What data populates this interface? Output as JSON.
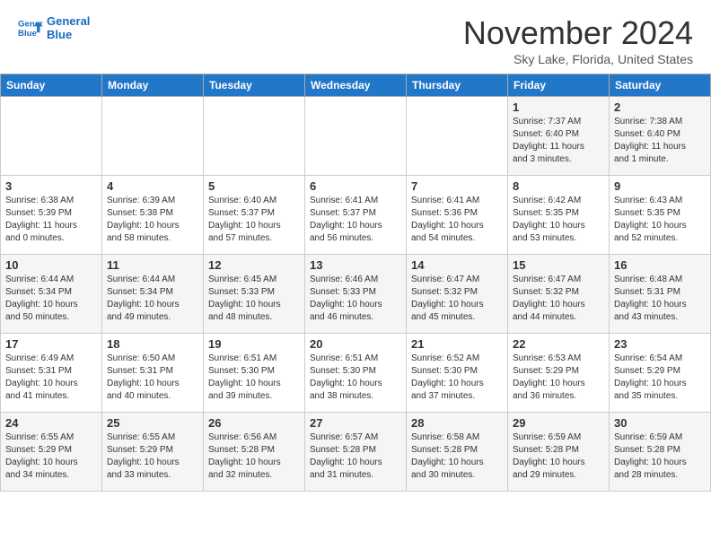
{
  "header": {
    "logo_line1": "General",
    "logo_line2": "Blue",
    "month": "November 2024",
    "location": "Sky Lake, Florida, United States"
  },
  "weekdays": [
    "Sunday",
    "Monday",
    "Tuesday",
    "Wednesday",
    "Thursday",
    "Friday",
    "Saturday"
  ],
  "weeks": [
    [
      {
        "day": "",
        "info": ""
      },
      {
        "day": "",
        "info": ""
      },
      {
        "day": "",
        "info": ""
      },
      {
        "day": "",
        "info": ""
      },
      {
        "day": "",
        "info": ""
      },
      {
        "day": "1",
        "info": "Sunrise: 7:37 AM\nSunset: 6:40 PM\nDaylight: 11 hours\nand 3 minutes."
      },
      {
        "day": "2",
        "info": "Sunrise: 7:38 AM\nSunset: 6:40 PM\nDaylight: 11 hours\nand 1 minute."
      }
    ],
    [
      {
        "day": "3",
        "info": "Sunrise: 6:38 AM\nSunset: 5:39 PM\nDaylight: 11 hours\nand 0 minutes."
      },
      {
        "day": "4",
        "info": "Sunrise: 6:39 AM\nSunset: 5:38 PM\nDaylight: 10 hours\nand 58 minutes."
      },
      {
        "day": "5",
        "info": "Sunrise: 6:40 AM\nSunset: 5:37 PM\nDaylight: 10 hours\nand 57 minutes."
      },
      {
        "day": "6",
        "info": "Sunrise: 6:41 AM\nSunset: 5:37 PM\nDaylight: 10 hours\nand 56 minutes."
      },
      {
        "day": "7",
        "info": "Sunrise: 6:41 AM\nSunset: 5:36 PM\nDaylight: 10 hours\nand 54 minutes."
      },
      {
        "day": "8",
        "info": "Sunrise: 6:42 AM\nSunset: 5:35 PM\nDaylight: 10 hours\nand 53 minutes."
      },
      {
        "day": "9",
        "info": "Sunrise: 6:43 AM\nSunset: 5:35 PM\nDaylight: 10 hours\nand 52 minutes."
      }
    ],
    [
      {
        "day": "10",
        "info": "Sunrise: 6:44 AM\nSunset: 5:34 PM\nDaylight: 10 hours\nand 50 minutes."
      },
      {
        "day": "11",
        "info": "Sunrise: 6:44 AM\nSunset: 5:34 PM\nDaylight: 10 hours\nand 49 minutes."
      },
      {
        "day": "12",
        "info": "Sunrise: 6:45 AM\nSunset: 5:33 PM\nDaylight: 10 hours\nand 48 minutes."
      },
      {
        "day": "13",
        "info": "Sunrise: 6:46 AM\nSunset: 5:33 PM\nDaylight: 10 hours\nand 46 minutes."
      },
      {
        "day": "14",
        "info": "Sunrise: 6:47 AM\nSunset: 5:32 PM\nDaylight: 10 hours\nand 45 minutes."
      },
      {
        "day": "15",
        "info": "Sunrise: 6:47 AM\nSunset: 5:32 PM\nDaylight: 10 hours\nand 44 minutes."
      },
      {
        "day": "16",
        "info": "Sunrise: 6:48 AM\nSunset: 5:31 PM\nDaylight: 10 hours\nand 43 minutes."
      }
    ],
    [
      {
        "day": "17",
        "info": "Sunrise: 6:49 AM\nSunset: 5:31 PM\nDaylight: 10 hours\nand 41 minutes."
      },
      {
        "day": "18",
        "info": "Sunrise: 6:50 AM\nSunset: 5:31 PM\nDaylight: 10 hours\nand 40 minutes."
      },
      {
        "day": "19",
        "info": "Sunrise: 6:51 AM\nSunset: 5:30 PM\nDaylight: 10 hours\nand 39 minutes."
      },
      {
        "day": "20",
        "info": "Sunrise: 6:51 AM\nSunset: 5:30 PM\nDaylight: 10 hours\nand 38 minutes."
      },
      {
        "day": "21",
        "info": "Sunrise: 6:52 AM\nSunset: 5:30 PM\nDaylight: 10 hours\nand 37 minutes."
      },
      {
        "day": "22",
        "info": "Sunrise: 6:53 AM\nSunset: 5:29 PM\nDaylight: 10 hours\nand 36 minutes."
      },
      {
        "day": "23",
        "info": "Sunrise: 6:54 AM\nSunset: 5:29 PM\nDaylight: 10 hours\nand 35 minutes."
      }
    ],
    [
      {
        "day": "24",
        "info": "Sunrise: 6:55 AM\nSunset: 5:29 PM\nDaylight: 10 hours\nand 34 minutes."
      },
      {
        "day": "25",
        "info": "Sunrise: 6:55 AM\nSunset: 5:29 PM\nDaylight: 10 hours\nand 33 minutes."
      },
      {
        "day": "26",
        "info": "Sunrise: 6:56 AM\nSunset: 5:28 PM\nDaylight: 10 hours\nand 32 minutes."
      },
      {
        "day": "27",
        "info": "Sunrise: 6:57 AM\nSunset: 5:28 PM\nDaylight: 10 hours\nand 31 minutes."
      },
      {
        "day": "28",
        "info": "Sunrise: 6:58 AM\nSunset: 5:28 PM\nDaylight: 10 hours\nand 30 minutes."
      },
      {
        "day": "29",
        "info": "Sunrise: 6:59 AM\nSunset: 5:28 PM\nDaylight: 10 hours\nand 29 minutes."
      },
      {
        "day": "30",
        "info": "Sunrise: 6:59 AM\nSunset: 5:28 PM\nDaylight: 10 hours\nand 28 minutes."
      }
    ]
  ]
}
